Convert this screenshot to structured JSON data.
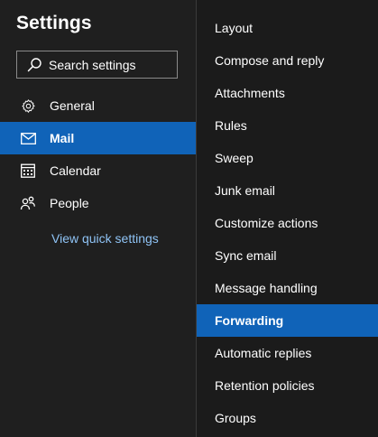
{
  "header": {
    "title": "Settings"
  },
  "search": {
    "placeholder": "Search settings",
    "icon": "search-icon"
  },
  "nav": {
    "items": [
      {
        "label": "General",
        "icon": "gear-icon",
        "active": false
      },
      {
        "label": "Mail",
        "icon": "mail-icon",
        "active": true
      },
      {
        "label": "Calendar",
        "icon": "calendar-icon",
        "active": false
      },
      {
        "label": "People",
        "icon": "people-icon",
        "active": false
      }
    ],
    "quick_settings_link": "View quick settings"
  },
  "mail_subnav": {
    "items": [
      {
        "label": "Layout",
        "active": false
      },
      {
        "label": "Compose and reply",
        "active": false
      },
      {
        "label": "Attachments",
        "active": false
      },
      {
        "label": "Rules",
        "active": false
      },
      {
        "label": "Sweep",
        "active": false
      },
      {
        "label": "Junk email",
        "active": false
      },
      {
        "label": "Customize actions",
        "active": false
      },
      {
        "label": "Sync email",
        "active": false
      },
      {
        "label": "Message handling",
        "active": false
      },
      {
        "label": "Forwarding",
        "active": true
      },
      {
        "label": "Automatic replies",
        "active": false
      },
      {
        "label": "Retention policies",
        "active": false
      },
      {
        "label": "Groups",
        "active": false
      }
    ]
  },
  "colors": {
    "accent": "#1063b8",
    "link": "#8fc3f5",
    "background": "#1f1f1f"
  }
}
